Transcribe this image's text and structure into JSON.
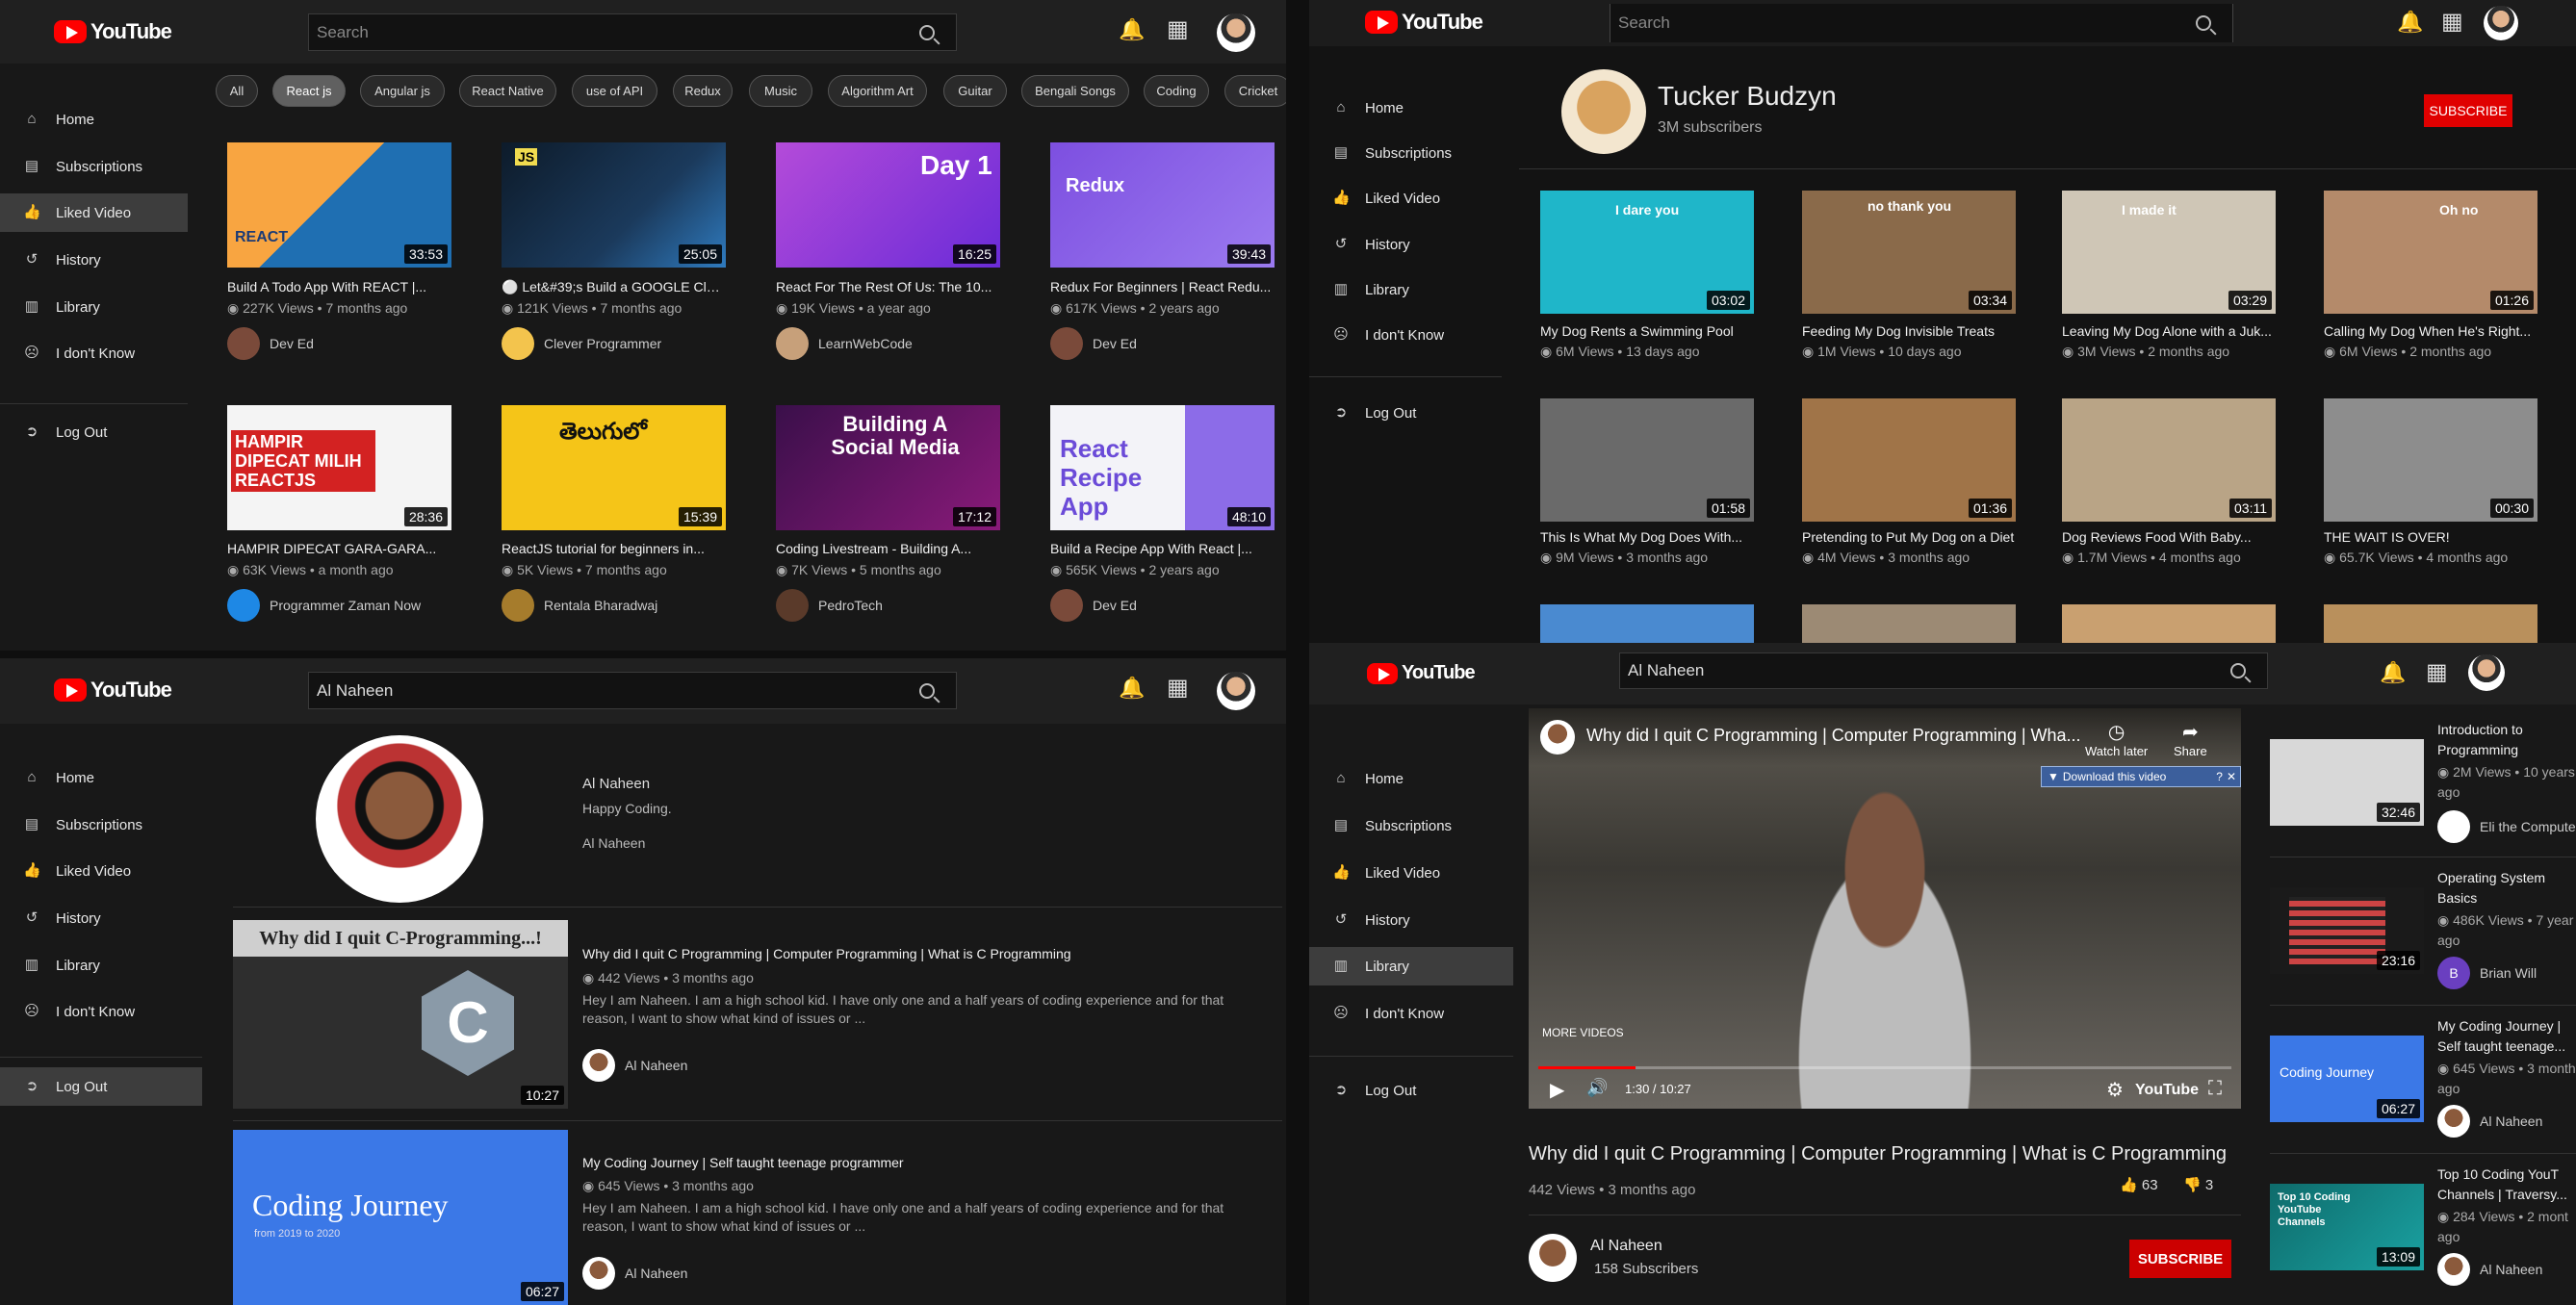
{
  "brand": {
    "name": "YouTube",
    "accent": "#ff0000"
  },
  "nav": {
    "home": "Home",
    "subscriptions": "Subscriptions",
    "liked": "Liked Video",
    "history": "History",
    "library": "Library",
    "dontknow": "I don't Know",
    "logout": "Log Out"
  },
  "panel_tl": {
    "search_placeholder": "Search",
    "chips": [
      "All",
      "React js",
      "Angular js",
      "React Native",
      "use of API",
      "Redux",
      "Music",
      "Algorithm Art",
      "Guitar",
      "Bengali Songs",
      "Coding",
      "Cricket"
    ],
    "videos": [
      {
        "title": "Build A Todo App With REACT |...",
        "meta": "227K Views • 7 months ago",
        "channel": "Dev Ed",
        "duration": "33:53",
        "thumb": "REACT"
      },
      {
        "title": "⚪ Let&#39;s Build a GOOGLE Clon...",
        "meta": "121K Views • 7 months ago",
        "channel": "Clever Programmer",
        "duration": "25:05",
        "thumb": "JS"
      },
      {
        "title": "React For The Rest Of Us: The 10...",
        "meta": "19K Views • a year ago",
        "channel": "LearnWebCode",
        "duration": "16:25",
        "thumb": "Day 1"
      },
      {
        "title": "Redux For Beginners | React Redu...",
        "meta": "617K Views • 2 years ago",
        "channel": "Dev Ed",
        "duration": "39:43",
        "thumb": "Redux"
      },
      {
        "title": "HAMPIR DIPECAT GARA-GARA...",
        "meta": "63K Views • a month ago",
        "channel": "Programmer Zaman Now",
        "duration": "28:36",
        "thumb": "HAMPIR DIPECAT MILIH REACTJS"
      },
      {
        "title": "ReactJS tutorial for beginners in...",
        "meta": "5K Views • 7 months ago",
        "channel": "Rentala Bharadwaj",
        "duration": "15:39",
        "thumb": "తెలుగులో"
      },
      {
        "title": "Coding Livestream - Building A...",
        "meta": "7K Views • 5 months ago",
        "channel": "PedroTech",
        "duration": "17:12",
        "thumb": "Building A Social Media"
      },
      {
        "title": "Build a Recipe App With React |...",
        "meta": "565K Views • 2 years ago",
        "channel": "Dev Ed",
        "duration": "48:10",
        "thumb": "React Recipe App"
      }
    ]
  },
  "panel_tr": {
    "search_placeholder": "Search",
    "channel_name": "Tucker Budzyn",
    "subscribers": "3M subscribers",
    "subscribe": "SUBSCRIBE",
    "videos": [
      {
        "title": "My Dog Rents a Swimming Pool",
        "meta": "6M Views • 13 days ago",
        "duration": "03:02",
        "color": "#1fb6c9"
      },
      {
        "title": "Feeding My Dog Invisible Treats",
        "meta": "1M Views • 10 days ago",
        "duration": "03:34",
        "color": "#8a6a4a"
      },
      {
        "title": "Leaving My Dog Alone with a Juk...",
        "meta": "3M Views • 2 months ago",
        "duration": "03:29",
        "color": "#cfc6b6"
      },
      {
        "title": "Calling My Dog When He's Right...",
        "meta": "6M Views • 2 months ago",
        "duration": "01:26",
        "color": "#b48a6a"
      },
      {
        "title": "This Is What My Dog Does With...",
        "meta": "9M Views • 3 months ago",
        "duration": "01:58",
        "color": "#6a6a6a"
      },
      {
        "title": "Pretending to Put My Dog on a Diet",
        "meta": "4M Views • 3 months ago",
        "duration": "01:36",
        "color": "#a07448"
      },
      {
        "title": "Dog Reviews Food With Baby...",
        "meta": "1.7M Views • 4 months ago",
        "duration": "03:11",
        "color": "#b9a486"
      },
      {
        "title": "THE WAIT IS OVER!",
        "meta": "65.7K Views • 4 months ago",
        "duration": "00:30",
        "color": "#8d8d8d"
      }
    ],
    "overlay_texts": [
      "I dare you",
      "no thank you",
      "I made it",
      "Oh no"
    ]
  },
  "panel_bl": {
    "search_value": "Al Naheen",
    "profile_name": "Al Naheen",
    "profile_bio": "Happy Coding.",
    "profile_handle": "Al Naheen",
    "videos": [
      {
        "title": "Why did I quit C Programming | Computer Programming | What is C Programming",
        "meta": "442 Views • 3 months ago",
        "desc": "Hey I am Naheen. I am a high school kid. I have only one and a half years of coding experience and for that reason, I want to show what kind of issues or ...",
        "channel": "Al Naheen",
        "duration": "10:27",
        "thumb_caption": "Why did I quit C-Programming...!"
      },
      {
        "title": "My Coding Journey | Self taught teenage programmer",
        "meta": "645 Views • 3 months ago",
        "desc": "Hey I am Naheen. I am a high school kid. I have only one and a half years of coding experience and for that reason, I want to show what kind of issues or ...",
        "channel": "Al Naheen",
        "duration": "06:27",
        "thumb_caption": "Coding Journey",
        "thumb_sub": "from 2019 to 2020"
      }
    ]
  },
  "panel_br": {
    "search_value": "Al Naheen",
    "player": {
      "title": "Why did I quit C Programming | Computer Programming | Wha...",
      "watch_later": "Watch later",
      "share": "Share",
      "download": "Download this video",
      "more_videos": "MORE VIDEOS",
      "time": "1:30 / 10:27",
      "progress_fraction": 0.14,
      "brand": "YouTube"
    },
    "video_title": "Why did I quit C Programming | Computer Programming | What is C Programming",
    "meta": "442 Views • 3 months ago",
    "likes": "63",
    "dislikes": "3",
    "channel": "Al Naheen",
    "subscribers": "158  Subscribers",
    "subscribe": "SUBSCRIBE",
    "related": [
      {
        "title1": "Introduction to",
        "title2": "Programming",
        "meta1": "2M Views • 10 years",
        "meta2": "ago",
        "channel": "Eli the Compute",
        "duration": "32:46"
      },
      {
        "title1": "Operating System",
        "title2": "Basics",
        "meta1": "486K Views • 7 year",
        "meta2": "ago",
        "channel": "Brian Will",
        "duration": "23:16"
      },
      {
        "title1": "My Coding Journey |",
        "title2": "Self taught teenage...",
        "meta1": "645 Views • 3 month",
        "meta2": "ago",
        "channel": "Al Naheen",
        "duration": "06:27",
        "thumb": "Coding Journey"
      },
      {
        "title1": "Top 10 Coding YouT",
        "title2": "Channels | Traversy...",
        "meta1": "284 Views • 2 mont",
        "meta2": "ago",
        "channel": "Al Naheen",
        "duration": "13:09",
        "thumb": "Top 10 Coding YouTube Channels"
      }
    ]
  }
}
